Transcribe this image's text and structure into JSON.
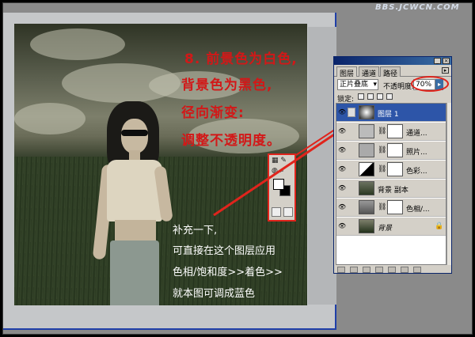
{
  "watermark": "BBS.JCWCN.COM",
  "steps": {
    "line1": "8. 前景色为白色,",
    "line2": "背景色为黑色,",
    "line3": "径向渐变:",
    "line4": "调整不透明度。"
  },
  "note": {
    "line1": "补充一下,",
    "line2": "可直接在这个图层应用",
    "line3": "色相/饱和度>>着色>>",
    "line4": "就本图可调成蓝色"
  },
  "layers_panel": {
    "tabs": [
      "图层",
      "通道",
      "路径"
    ],
    "blend_mode": "正片叠底",
    "opacity_label": "不透明度:",
    "opacity_value": "70%",
    "lock_label": "锁定:",
    "layers": [
      {
        "name": "图层 1",
        "active": true
      },
      {
        "name": "通道...",
        "active": false
      },
      {
        "name": "照片...",
        "active": false
      },
      {
        "name": "色彩...",
        "active": false
      },
      {
        "name": "背景 副本",
        "active": false
      },
      {
        "name": "色相/...",
        "active": false
      },
      {
        "name": "背景",
        "active": false
      }
    ]
  },
  "colors": {
    "accent_red": "#e0241c",
    "selection_blue": "#2d55a8"
  }
}
